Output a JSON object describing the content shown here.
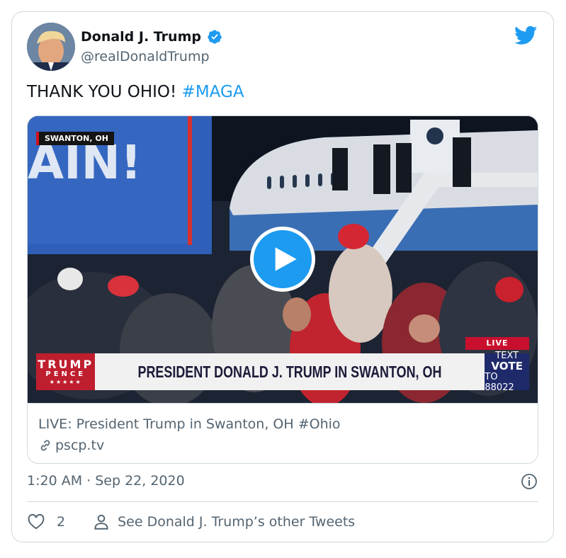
{
  "author": {
    "display_name": "Donald J. Trump",
    "handle": "@realDonaldTrump",
    "verified": true
  },
  "tweet": {
    "text": "THANK YOU OHIO! ",
    "hashtag": "#MAGA"
  },
  "video": {
    "location_tag": "SWANTON, OH",
    "live_badge": "LIVE",
    "chyron": {
      "logo_top": "TRUMP",
      "logo_middle": "PENCE",
      "logo_stars": "★★★★★",
      "headline": "PRESIDENT DONALD J. TRUMP IN SWANTON, OH",
      "vote_line1": "TEXT",
      "vote_line2": "VOTE",
      "vote_line3": "TO 88022"
    },
    "backdrop_text": "AIN!"
  },
  "link_card": {
    "title": "LIVE: President Trump in Swanton, OH #Ohio",
    "domain": "pscp.tv"
  },
  "meta": {
    "timestamp": "1:20 AM · Sep 22, 2020"
  },
  "footer": {
    "like_count": "2",
    "other_tweets": "See Donald J. Trump’s other Tweets"
  },
  "colors": {
    "accent": "#1d9bf0",
    "secondary_text": "#536471",
    "border": "#cfd9de"
  },
  "icons": [
    "twitter-bird-icon",
    "verified-badge-icon",
    "play-icon",
    "link-icon",
    "info-icon",
    "heart-icon",
    "person-icon"
  ]
}
